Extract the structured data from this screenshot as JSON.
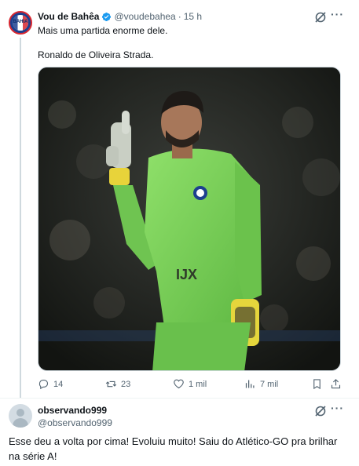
{
  "tweet": {
    "author_name": "Vou de Bahêa",
    "author_handle": "@voudebahea",
    "separator": "·",
    "time": "15 h",
    "text_line1": "Mais uma partida enorme dele.",
    "text_line2": "Ronaldo de Oliveira Strada.",
    "media_icon": "photo-goalkeeper-gesture",
    "avatar_text": "BAHIA",
    "actions": {
      "replies": "14",
      "retweets": "23",
      "likes": "1 mil",
      "views": "7 mil"
    },
    "colors": {
      "verified": "#1d9bf0",
      "text_secondary": "#536471",
      "jersey": "#7fd35a"
    }
  },
  "reply": {
    "author_name": "observando999",
    "author_handle": "@observando999",
    "text": "Esse deu a volta por cima! Evoluiu muito! Saiu do Atlético-GO pra brilhar na série A!"
  }
}
